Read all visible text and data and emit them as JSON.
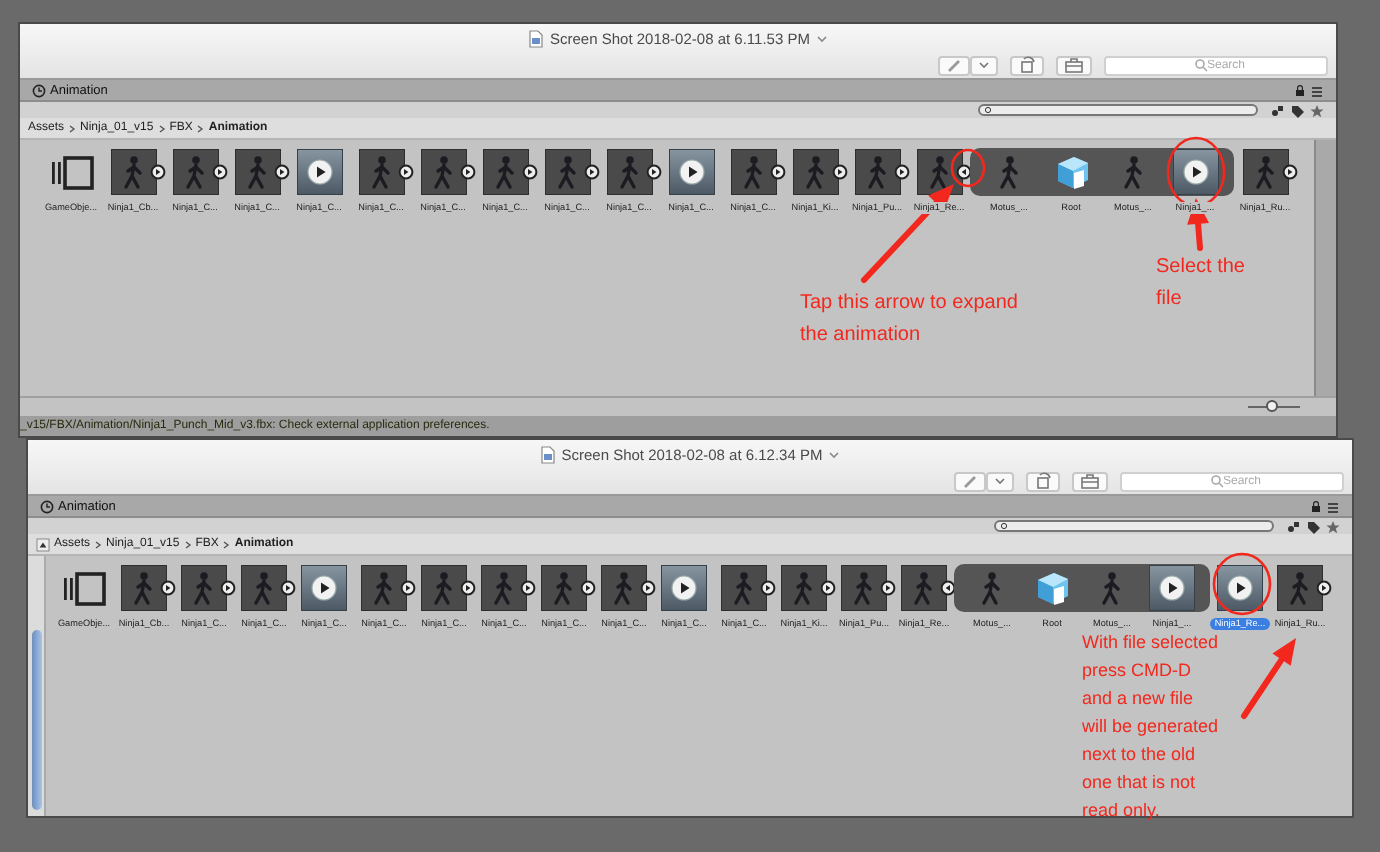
{
  "shots": [
    {
      "title": "Screen Shot 2018-02-08 at 6.11.53 PM",
      "search": {
        "placeholder": "Search"
      },
      "panel": {
        "title": "Animation"
      },
      "breadcrumb": [
        "Assets",
        "Ninja_01_v15",
        "FBX",
        "Animation"
      ],
      "vertical_scrollbar": false,
      "items": [
        {
          "kind": "prefab",
          "label": "GameObje...",
          "selected": false
        },
        {
          "kind": "clip",
          "label": "Ninja1_Cb...",
          "selected": false,
          "expanded": false
        },
        {
          "kind": "clip",
          "label": "Ninja1_C...",
          "selected": false,
          "expanded": false
        },
        {
          "kind": "clip",
          "label": "Ninja1_C...",
          "selected": false,
          "expanded": false
        },
        {
          "kind": "animation",
          "label": "Ninja1_C...",
          "selected": false
        },
        {
          "kind": "clip",
          "label": "Ninja1_C...",
          "selected": false,
          "expanded": false
        },
        {
          "kind": "clip",
          "label": "Ninja1_C...",
          "selected": false,
          "expanded": false
        },
        {
          "kind": "clip",
          "label": "Ninja1_C...",
          "selected": false,
          "expanded": false
        },
        {
          "kind": "clip",
          "label": "Ninja1_C...",
          "selected": false,
          "expanded": false
        },
        {
          "kind": "clip",
          "label": "Ninja1_C...",
          "selected": false,
          "expanded": false
        },
        {
          "kind": "animation",
          "label": "Ninja1_C...",
          "selected": false
        },
        {
          "kind": "clip",
          "label": "Ninja1_C...",
          "selected": false,
          "expanded": false
        },
        {
          "kind": "clip",
          "label": "Ninja1_Ki...",
          "selected": false,
          "expanded": false
        },
        {
          "kind": "clip",
          "label": "Ninja1_Pu...",
          "selected": false,
          "expanded": false
        },
        {
          "kind": "clip",
          "label": "Ninja1_Re...",
          "selected": false,
          "expanded": true,
          "children": [
            {
              "kind": "figure",
              "label": "Motus_...",
              "selected": false
            },
            {
              "kind": "mesh",
              "label": "Root",
              "selected": false
            },
            {
              "kind": "figure",
              "label": "Motus_...",
              "selected": false
            },
            {
              "kind": "animation",
              "label": "Ninja1_...",
              "selected": false
            }
          ]
        },
        {
          "kind": "clip",
          "label": "Ninja1_Ru...",
          "selected": false,
          "expanded": false
        }
      ],
      "notes": [
        {
          "text": "Tap this arrow to expand\nthe animation"
        },
        {
          "text": "Select the\nfile"
        }
      ],
      "size_slider": {
        "level": 0.45
      },
      "status": "_v15/FBX/Animation/Ninja1_Punch_Mid_v3.fbx: Check external application preferences."
    },
    {
      "title": "Screen Shot 2018-02-08 at 6.12.34 PM",
      "search": {
        "placeholder": "Search"
      },
      "panel": {
        "title": "Animation"
      },
      "breadcrumb": [
        "Assets",
        "Ninja_01_v15",
        "FBX",
        "Animation"
      ],
      "vertical_scrollbar": true,
      "items": [
        {
          "kind": "prefab",
          "label": "GameObje...",
          "selected": false
        },
        {
          "kind": "clip",
          "label": "Ninja1_Cb...",
          "selected": false,
          "expanded": false
        },
        {
          "kind": "clip",
          "label": "Ninja1_C...",
          "selected": false,
          "expanded": false
        },
        {
          "kind": "clip",
          "label": "Ninja1_C...",
          "selected": false,
          "expanded": false
        },
        {
          "kind": "animation",
          "label": "Ninja1_C...",
          "selected": false
        },
        {
          "kind": "clip",
          "label": "Ninja1_C...",
          "selected": false,
          "expanded": false
        },
        {
          "kind": "clip",
          "label": "Ninja1_C...",
          "selected": false,
          "expanded": false
        },
        {
          "kind": "clip",
          "label": "Ninja1_C...",
          "selected": false,
          "expanded": false
        },
        {
          "kind": "clip",
          "label": "Ninja1_C...",
          "selected": false,
          "expanded": false
        },
        {
          "kind": "clip",
          "label": "Ninja1_C...",
          "selected": false,
          "expanded": false
        },
        {
          "kind": "animation",
          "label": "Ninja1_C...",
          "selected": false
        },
        {
          "kind": "clip",
          "label": "Ninja1_C...",
          "selected": false,
          "expanded": false
        },
        {
          "kind": "clip",
          "label": "Ninja1_Ki...",
          "selected": false,
          "expanded": false
        },
        {
          "kind": "clip",
          "label": "Ninja1_Pu...",
          "selected": false,
          "expanded": false
        },
        {
          "kind": "clip",
          "label": "Ninja1_Re...",
          "selected": false,
          "expanded": true,
          "children": [
            {
              "kind": "figure",
              "label": "Motus_...",
              "selected": false
            },
            {
              "kind": "mesh",
              "label": "Root",
              "selected": false
            },
            {
              "kind": "figure",
              "label": "Motus_...",
              "selected": false
            },
            {
              "kind": "animation",
              "label": "Ninja1_...",
              "selected": false
            }
          ]
        },
        {
          "kind": "animation",
          "label": "Ninja1_Re...",
          "selected": true
        },
        {
          "kind": "clip",
          "label": "Ninja1_Ru...",
          "selected": false,
          "expanded": false
        }
      ],
      "notes": [
        {
          "text": "With file selected\npress CMD-D\nand a new file\nwill be generated\nnext to the old\none that is not\nread only."
        }
      ]
    }
  ]
}
